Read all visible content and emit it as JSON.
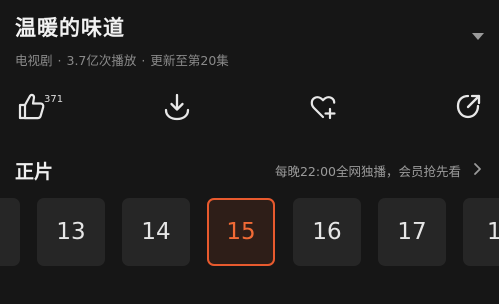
{
  "show": {
    "title": "温暖的味道",
    "category": "电视剧",
    "plays": "3.7亿次播放",
    "update_status": "更新至第20集"
  },
  "actions": {
    "like_count": "371",
    "icons": [
      "thumbs-up-icon",
      "download-icon",
      "heart-add-icon",
      "share-icon"
    ]
  },
  "episodes_section": {
    "title": "正片",
    "notice": "每晚22:00全网独播，会员抢先看",
    "episodes": [
      {
        "label": "",
        "selected": false
      },
      {
        "label": "13",
        "selected": false
      },
      {
        "label": "14",
        "selected": false
      },
      {
        "label": "15",
        "selected": true
      },
      {
        "label": "16",
        "selected": false
      },
      {
        "label": "17",
        "selected": false
      },
      {
        "label": "1",
        "selected": false
      }
    ]
  },
  "colors": {
    "background": "#161616",
    "tile": "#262626",
    "accent": "#e85a2e"
  }
}
